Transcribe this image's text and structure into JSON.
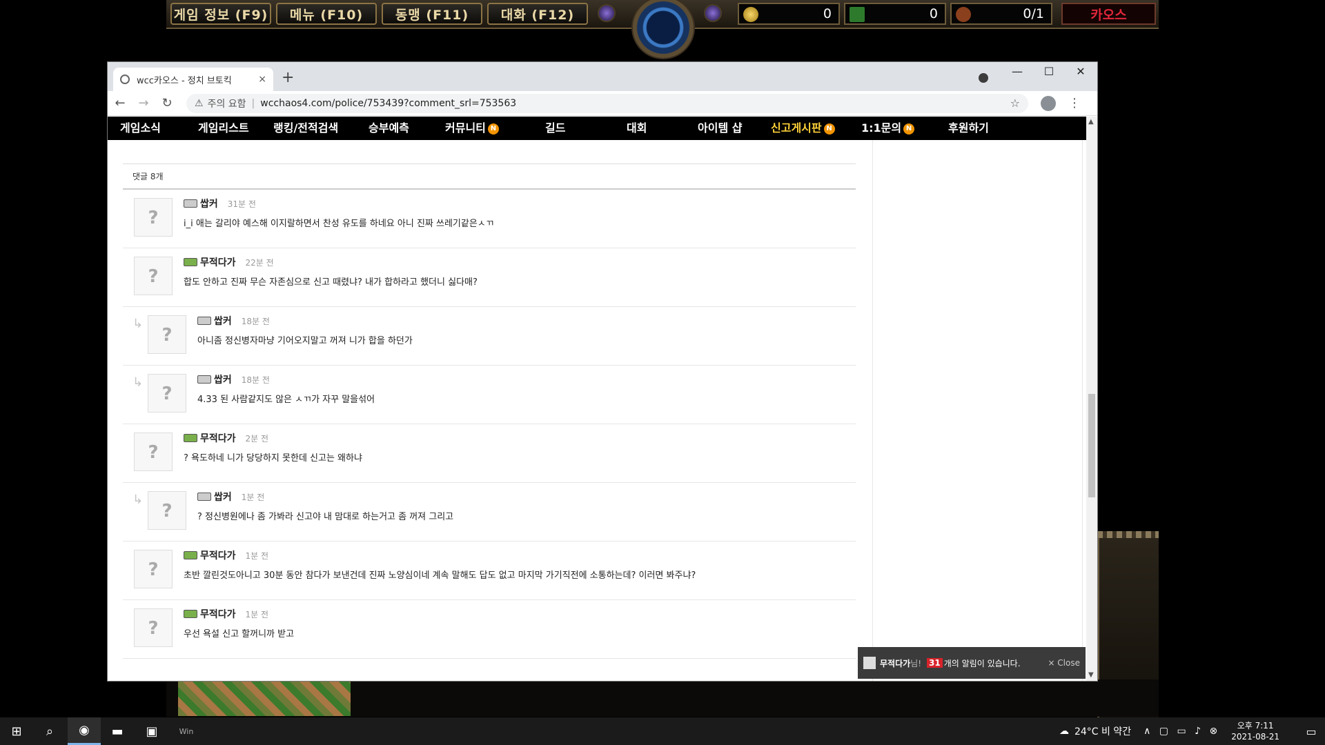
{
  "hud": {
    "buttons": [
      "게임 정보 (F9)",
      "메뉴 (F10)",
      "동맹 (F11)",
      "대화 (F12)"
    ],
    "gold": "0",
    "lumber": "0",
    "food": "0/1",
    "chaos_label": "카오스"
  },
  "browser": {
    "tab_title": "wcc카오스 - 정치 브토킥",
    "tab_close": "×",
    "new_tab": "+",
    "security_text": "주의 요함",
    "url": "wcchaos4.com/police/753439?comment_srl=753563"
  },
  "site_nav": [
    {
      "label": "게임소식",
      "badge": ""
    },
    {
      "label": "게임리스트",
      "badge": ""
    },
    {
      "label": "랭킹/전적검색",
      "badge": ""
    },
    {
      "label": "승부예측",
      "badge": ""
    },
    {
      "label": "커뮤니티",
      "badge": "N"
    },
    {
      "label": "길드",
      "badge": ""
    },
    {
      "label": "대회",
      "badge": ""
    },
    {
      "label": "아이템 샵",
      "badge": ""
    },
    {
      "label": "신고게시판",
      "badge": "N"
    },
    {
      "label": "1:1문의",
      "badge": "N"
    },
    {
      "label": "후원하기",
      "badge": ""
    }
  ],
  "comments_header": "댓글 8개",
  "comments": [
    {
      "author": "쌉커",
      "time": "31분 전",
      "text": "i_i 애는 갈리야 예스해 이지랄하면서 찬성 유도를 하네요 아니 진짜 쓰레기같은ㅅㄲ",
      "reply": false,
      "level": "gray"
    },
    {
      "author": "무적다가",
      "time": "22분 전",
      "text": "합도 안하고 진짜 무슨 자존심으로 신고 때렸냐? 내가 합하라고 했더니 싫다매?",
      "reply": false,
      "level": "green"
    },
    {
      "author": "쌉커",
      "time": "18분 전",
      "text": "아니좀 정신병자마냥 기어오지말고 꺼져 니가 합을 하던가",
      "reply": true,
      "level": "gray"
    },
    {
      "author": "쌉커",
      "time": "18분 전",
      "text": "4.33 된 사람같지도 않은 ㅅㄲ가 자꾸 말을섞어",
      "reply": true,
      "level": "gray"
    },
    {
      "author": "무적다가",
      "time": "2분 전",
      "text": "? 욕도하네 니가 당당하지 못한데 신고는 왜하냐",
      "reply": false,
      "level": "green"
    },
    {
      "author": "쌉커",
      "time": "1분 전",
      "text": "? 정신병원에나 좀 가봐라 신고야 내 맘대로 하는거고 좀 꺼져 그리고",
      "reply": true,
      "level": "gray"
    },
    {
      "author": "무적다가",
      "time": "1분 전",
      "text": "초반 깔린것도아니고 30분 동안 참다가 보낸건데 진짜 노양심이네 계속 말해도 답도 없고 마지막 가기직전에 소통하는데? 이러면 봐주냐?",
      "reply": false,
      "level": "green"
    },
    {
      "author": "무적다가",
      "time": "1분 전",
      "text": "우선 욕설 신고 할꺼니까 받고",
      "reply": false,
      "level": "green"
    }
  ],
  "avatar_placeholder": "?",
  "reply_glyph": "↳",
  "notice": {
    "name": "무적다가",
    "suffix": "님!",
    "count": "31",
    "message": "개의 알림이 있습니다.",
    "close": "× Close"
  },
  "taskbar": {
    "weather": "24°C  비 약간",
    "time": "오후 7:11",
    "date": "2021-08-21",
    "app_label": "Win"
  },
  "colors": {
    "nav_highlight": "#ffd23a",
    "badge": "#f39400",
    "chaos": "#e0263a"
  }
}
